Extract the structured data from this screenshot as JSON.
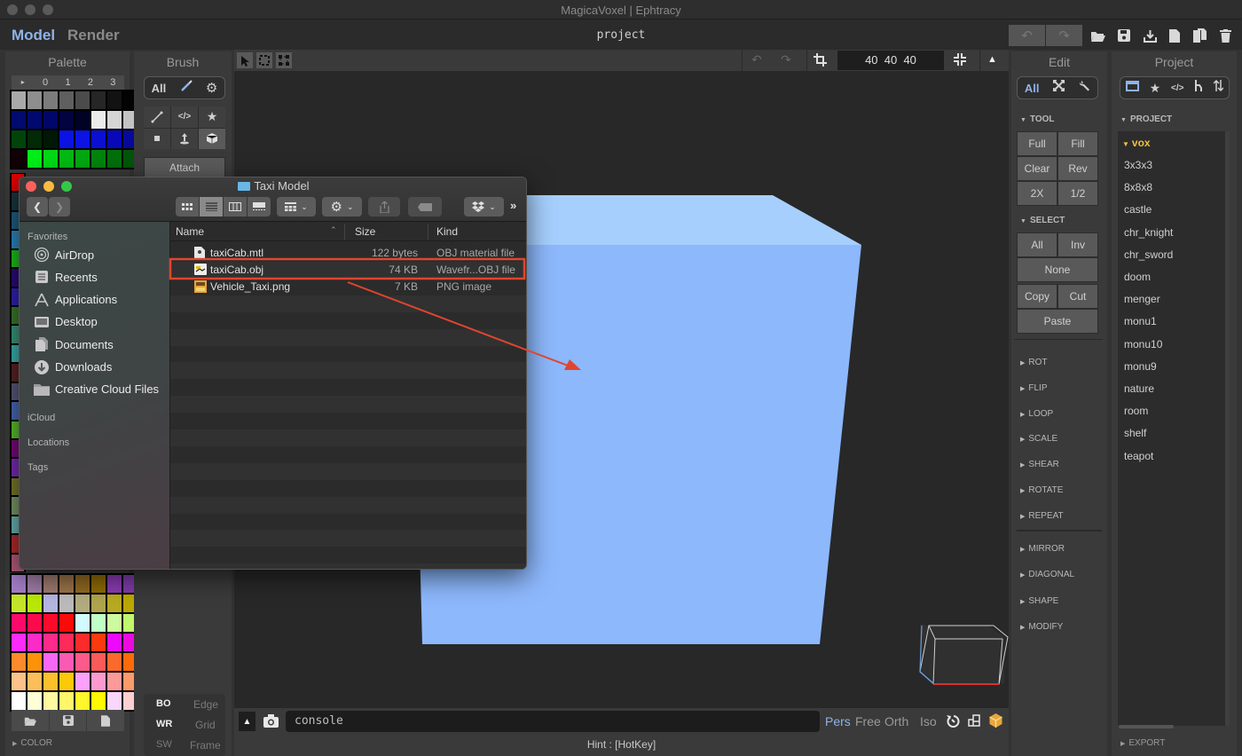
{
  "window": {
    "title": "MagicaVoxel | Ephtracy"
  },
  "header": {
    "modes": [
      {
        "label": "Model",
        "active": true
      },
      {
        "label": "Render",
        "active": false
      }
    ],
    "project_name": "project",
    "icons": [
      "undo-icon",
      "redo-icon",
      "open-folder-icon",
      "save-icon",
      "download-icon",
      "new-file-icon",
      "duplicate-icon",
      "trash-icon"
    ]
  },
  "palette": {
    "title": "Palette",
    "tabs": [
      "▸",
      "0",
      "1",
      "2",
      "3"
    ],
    "colors_top": [
      [
        "#a9a9a9",
        "#8e8e8e",
        "#7c7c7c",
        "#5f5f5f",
        "#4b4b4b",
        "#262626",
        "#121212",
        "#030303"
      ],
      [
        "#010a6e",
        "#010870",
        "#01066a",
        "#020340",
        "#010226",
        "#ebebeb",
        "#d5d5d5",
        "#c3c3c3"
      ],
      [
        "#01440a",
        "#012a05",
        "#011804",
        "#0a13e2",
        "#0b13e5",
        "#0a10d2",
        "#0709b8",
        "#07099b"
      ],
      [
        "#120206",
        "#00ee18",
        "#01d816",
        "#03b913",
        "#02a712",
        "#02840d",
        "#026f0c",
        "#02560a"
      ]
    ],
    "colors_bottom": [
      [
        "#a47ec8",
        "#9e7ca6",
        "#9e7a6e",
        "#9a7348",
        "#906822",
        "#8c6a06",
        "#8a3cb2",
        "#7e3ca8"
      ],
      [
        "#c4e52a",
        "#b9e808",
        "#b5b5e2",
        "#bbbbbb",
        "#b2ac7e",
        "#b0a44e",
        "#b8aa22",
        "#bca800"
      ],
      [
        "#fb0a6a",
        "#fb0a4c",
        "#fc0a2c",
        "#fb0a0a",
        "#d2fbff",
        "#c0ffc5",
        "#cdfa9e",
        "#c0f76c"
      ],
      [
        "#fc2bfc",
        "#fc2bc8",
        "#fc2b8a",
        "#fc2b5a",
        "#fc2b2b",
        "#fc3a0e",
        "#ec0afc",
        "#ec0ae0"
      ],
      [
        "#fc8a2b",
        "#fc920a",
        "#f667f6",
        "#fb5ab4",
        "#fb5a8a",
        "#fb5a5a",
        "#fb6a2b",
        "#fc6a0a"
      ],
      [
        "#fcc28a",
        "#fcbe5a",
        "#fcc02b",
        "#fcc80a",
        "#fca0fc",
        "#fc9ace",
        "#fc9a9a",
        "#fc9a6a"
      ],
      [
        "#ffffff",
        "#ffffd6",
        "#fffaa0",
        "#fff66c",
        "#fff62b",
        "#fffa00",
        "#fbd6fb",
        "#fcd0d0"
      ]
    ],
    "side_strip": [
      "#e00000",
      "#1a3640",
      "#1f5f84",
      "#2b8ac6",
      "#1cc21c",
      "#2b0c7a",
      "#3222b4",
      "#3b7a2b",
      "#3a9a7a",
      "#3ab4b4",
      "#5a2424",
      "#5a5a7a",
      "#4a6ab8",
      "#5ac22b",
      "#7a0a7a",
      "#7a2bb8",
      "#7a7a2b",
      "#7a9a6a",
      "#6ab4b4",
      "#b42b2b",
      "#b45a7a"
    ],
    "footer_icons": [
      "open-folder-icon",
      "save-icon",
      "file-icon"
    ],
    "color_section": "COLOR"
  },
  "brush": {
    "title": "Brush",
    "filter": [
      {
        "label": "All"
      },
      {
        "icon": "brush-icon"
      },
      {
        "icon": "gear-icon"
      }
    ],
    "tools": [
      "line-icon",
      "code-icon",
      "star-icon",
      "dot-icon",
      "extrude-icon",
      "cube-icon"
    ],
    "attach_label": "Attach",
    "toggles": [
      {
        "label": "BO",
        "on": true
      },
      {
        "label": "Edge",
        "on": false
      },
      {
        "label": "WR",
        "on": true
      },
      {
        "label": "Grid",
        "on": false
      },
      {
        "label": "SW",
        "on": false
      },
      {
        "label": "Frame",
        "on": false
      }
    ]
  },
  "viewport": {
    "dims": "40  40  40",
    "cube_color": "#8db8fc",
    "cube_top_color": "#a6cffd",
    "console_placeholder": "console",
    "camera_modes": [
      {
        "label": "Pers",
        "active": true
      },
      {
        "label": "Free",
        "active": false
      },
      {
        "label": "Orth",
        "active": false
      },
      {
        "label": "Iso",
        "active": false
      }
    ],
    "hint": "Hint : [HotKey]"
  },
  "finder": {
    "title": "Taxi Model",
    "sidebar": {
      "favorites_label": "Favorites",
      "favorites": [
        {
          "label": "AirDrop",
          "icon": "airdrop-icon"
        },
        {
          "label": "Recents",
          "icon": "recents-icon"
        },
        {
          "label": "Applications",
          "icon": "applications-icon"
        },
        {
          "label": "Desktop",
          "icon": "desktop-icon"
        },
        {
          "label": "Documents",
          "icon": "documents-icon"
        },
        {
          "label": "Downloads",
          "icon": "downloads-icon"
        },
        {
          "label": "Creative Cloud Files",
          "icon": "folder-icon"
        }
      ],
      "sections": [
        "iCloud",
        "Locations",
        "Tags"
      ]
    },
    "columns": {
      "name": "Name",
      "size": "Size",
      "kind": "Kind"
    },
    "files": [
      {
        "name": "taxiCab.mtl",
        "size": "122 bytes",
        "kind": "OBJ material file",
        "highlighted": false
      },
      {
        "name": "taxiCab.obj",
        "size": "74 KB",
        "kind": "Wavefr...OBJ file",
        "highlighted": true
      },
      {
        "name": "Vehicle_Taxi.png",
        "size": "7 KB",
        "kind": "PNG image",
        "highlighted": false
      }
    ]
  },
  "edit": {
    "title": "Edit",
    "filter": [
      {
        "label": "All"
      },
      {
        "icon": "expand-icon"
      },
      {
        "icon": "wrench-icon"
      }
    ],
    "tool_label": "TOOL",
    "tool_buttons": [
      "Full",
      "Fill",
      "Clear",
      "Rev",
      "2X",
      "1/2"
    ],
    "select_label": "SELECT",
    "select_buttons": {
      "all": "All",
      "inv": "Inv",
      "none": "None",
      "copy": "Copy",
      "cut": "Cut",
      "paste": "Paste"
    },
    "sections_a": [
      "ROT",
      "FLIP",
      "LOOP",
      "SCALE",
      "SHEAR",
      "ROTATE",
      "REPEAT"
    ],
    "sections_b": [
      "MIRROR",
      "DIAGONAL",
      "SHAPE",
      "MODIFY"
    ]
  },
  "project": {
    "title": "Project",
    "filter_icons": [
      "folder-icon",
      "star-icon",
      "code-icon",
      "branch-icon",
      "sort-icon"
    ],
    "section_label": "PROJECT",
    "folder": "vox",
    "items": [
      "3x3x3",
      "8x8x8",
      "castle",
      "chr_knight",
      "chr_sword",
      "doom",
      "menger",
      "monu1",
      "monu10",
      "monu9",
      "nature",
      "room",
      "shelf",
      "teapot"
    ],
    "export_label": "EXPORT"
  },
  "colors": {
    "accent": "#8fb3e8",
    "folder_yellow": "#f0c040",
    "annotation_red": "#e0452f"
  }
}
